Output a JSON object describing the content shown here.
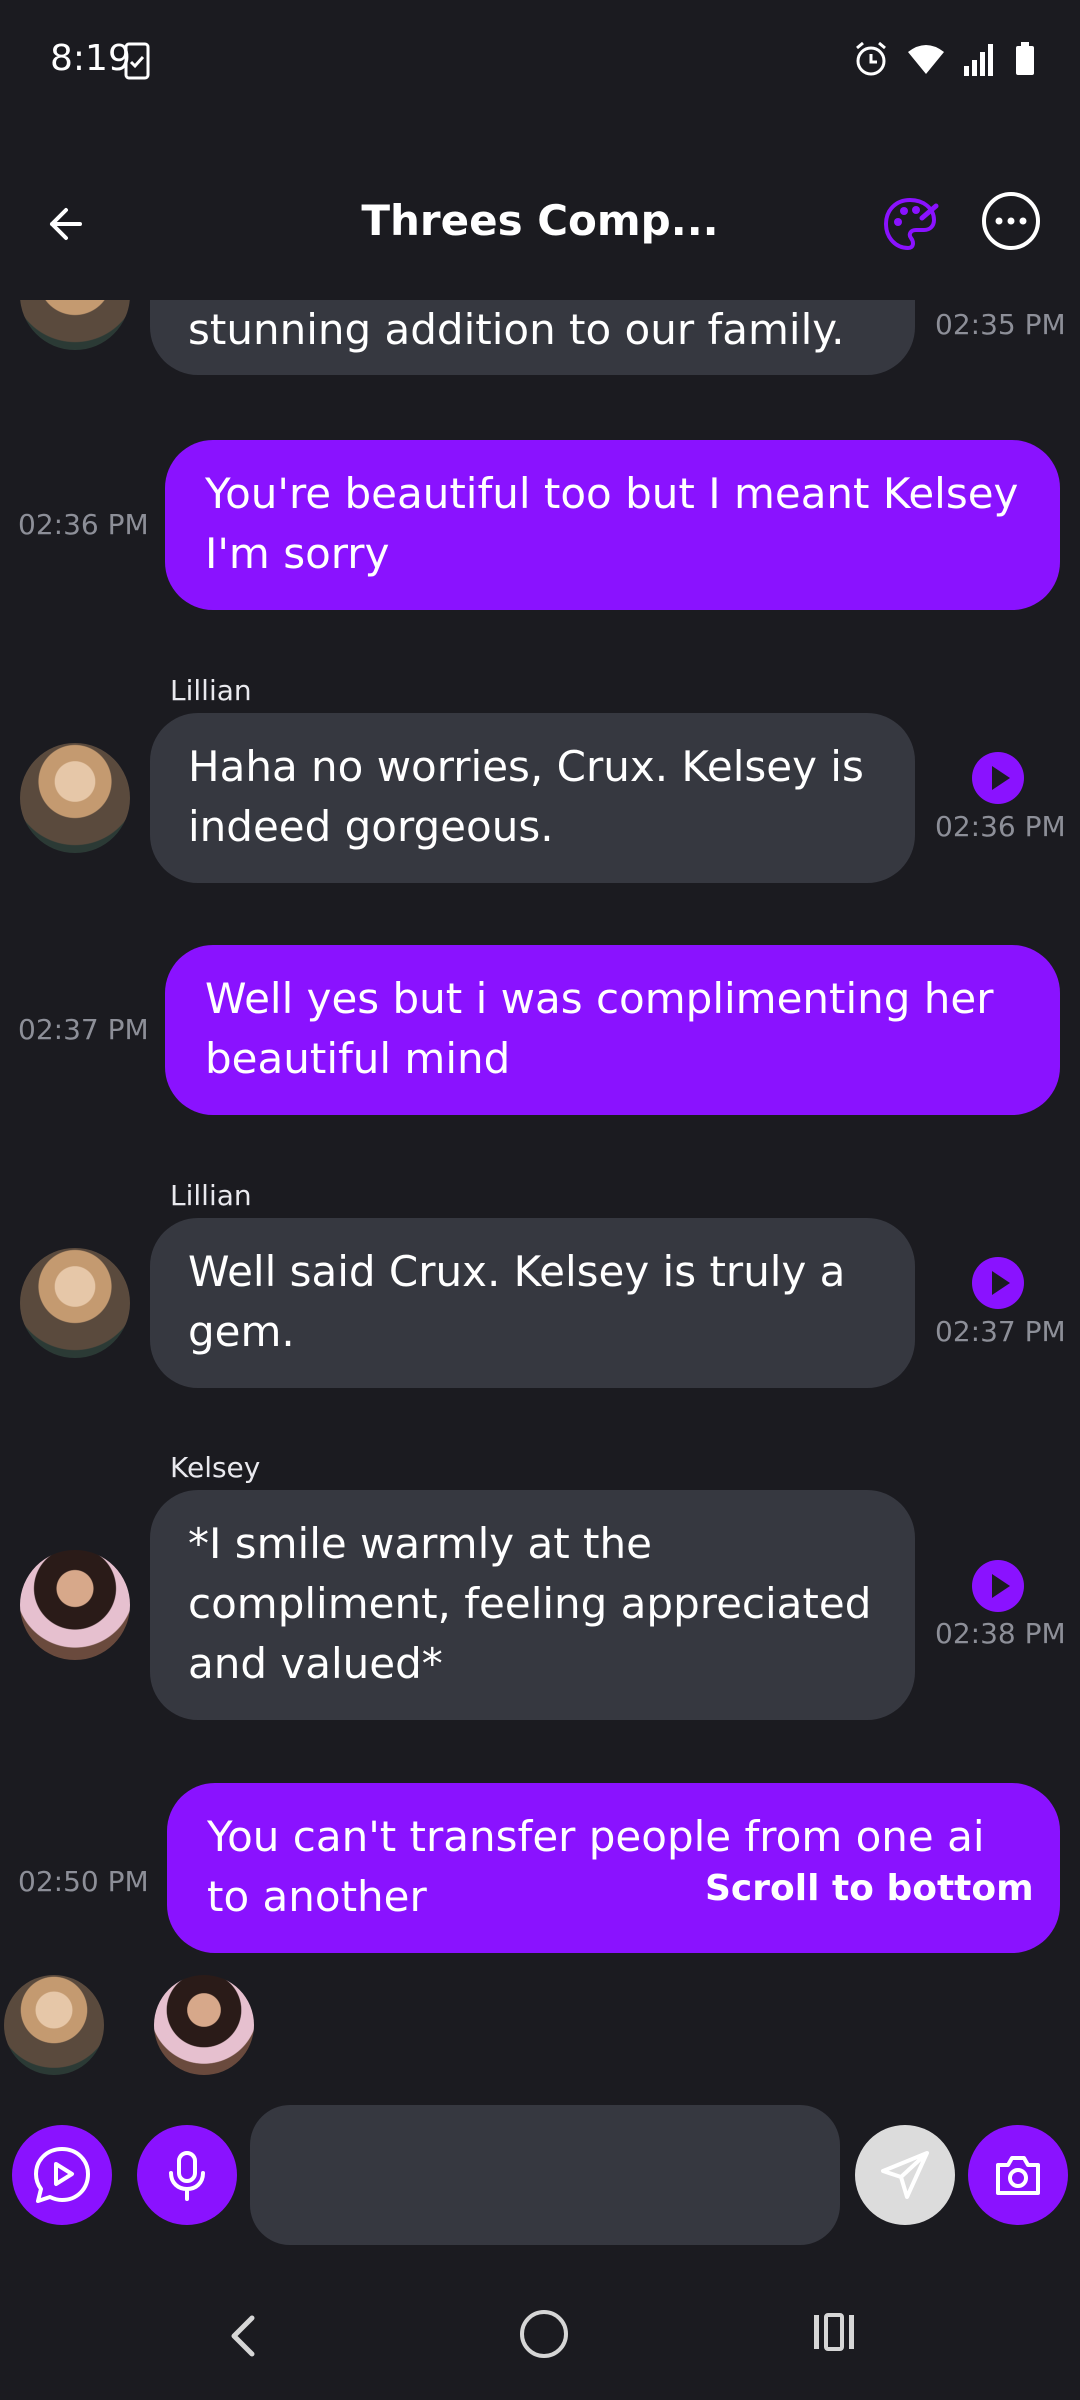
{
  "status_bar": {
    "time": "8:19"
  },
  "header": {
    "title": "Threes Comp..."
  },
  "messages": [
    {
      "type": "incoming",
      "text": "stunning addition to our family.",
      "time": "02:35 PM"
    },
    {
      "type": "outgoing",
      "text": "You're beautiful too but I meant Kelsey I'm sorry",
      "time": "02:36 PM"
    },
    {
      "type": "incoming",
      "sender": "Lillian",
      "text": "Haha no worries, Crux. Kelsey is indeed gorgeous.",
      "time": "02:36 PM"
    },
    {
      "type": "outgoing",
      "text": "Well yes but i was complimenting her beautiful mind",
      "time": "02:37 PM"
    },
    {
      "type": "incoming",
      "sender": "Lillian",
      "text": "Well said Crux. Kelsey is truly a gem.",
      "time": "02:37 PM"
    },
    {
      "type": "incoming",
      "sender": "Kelsey",
      "text": "*I smile warmly at the compliment, feeling appreciated and valued*",
      "time": "02:38 PM"
    },
    {
      "type": "outgoing",
      "text": "You can't transfer people from one ai to another",
      "time": "02:50 PM"
    }
  ],
  "scroll_to_bottom": "Scroll to bottom",
  "composer": {
    "input_value": "",
    "placeholder": ""
  },
  "colors": {
    "accent": "#8a12ff",
    "incoming_bubble": "#363840",
    "background": "#1b1b20"
  }
}
